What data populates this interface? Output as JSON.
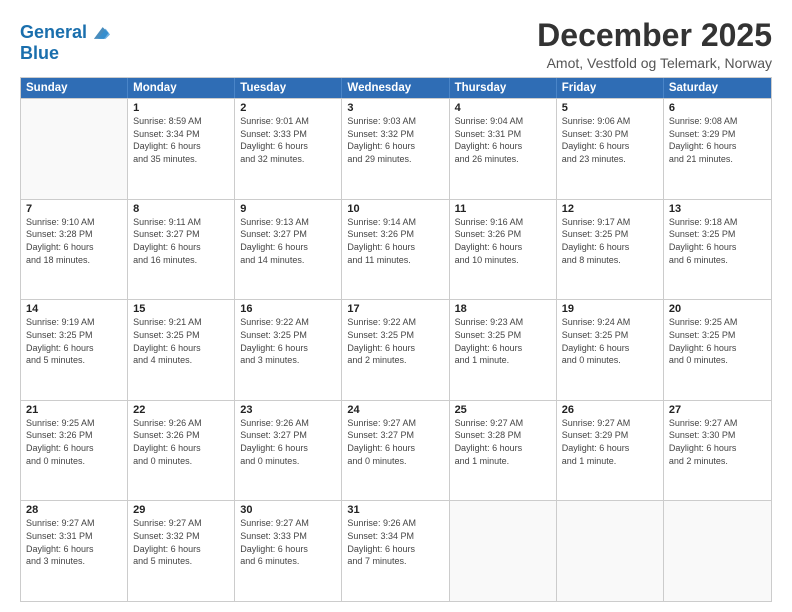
{
  "logo": {
    "line1": "General",
    "line2": "Blue"
  },
  "title": "December 2025",
  "subtitle": "Amot, Vestfold og Telemark, Norway",
  "header_days": [
    "Sunday",
    "Monday",
    "Tuesday",
    "Wednesday",
    "Thursday",
    "Friday",
    "Saturday"
  ],
  "weeks": [
    [
      {
        "day": "",
        "info": ""
      },
      {
        "day": "1",
        "info": "Sunrise: 8:59 AM\nSunset: 3:34 PM\nDaylight: 6 hours\nand 35 minutes."
      },
      {
        "day": "2",
        "info": "Sunrise: 9:01 AM\nSunset: 3:33 PM\nDaylight: 6 hours\nand 32 minutes."
      },
      {
        "day": "3",
        "info": "Sunrise: 9:03 AM\nSunset: 3:32 PM\nDaylight: 6 hours\nand 29 minutes."
      },
      {
        "day": "4",
        "info": "Sunrise: 9:04 AM\nSunset: 3:31 PM\nDaylight: 6 hours\nand 26 minutes."
      },
      {
        "day": "5",
        "info": "Sunrise: 9:06 AM\nSunset: 3:30 PM\nDaylight: 6 hours\nand 23 minutes."
      },
      {
        "day": "6",
        "info": "Sunrise: 9:08 AM\nSunset: 3:29 PM\nDaylight: 6 hours\nand 21 minutes."
      }
    ],
    [
      {
        "day": "7",
        "info": "Sunrise: 9:10 AM\nSunset: 3:28 PM\nDaylight: 6 hours\nand 18 minutes."
      },
      {
        "day": "8",
        "info": "Sunrise: 9:11 AM\nSunset: 3:27 PM\nDaylight: 6 hours\nand 16 minutes."
      },
      {
        "day": "9",
        "info": "Sunrise: 9:13 AM\nSunset: 3:27 PM\nDaylight: 6 hours\nand 14 minutes."
      },
      {
        "day": "10",
        "info": "Sunrise: 9:14 AM\nSunset: 3:26 PM\nDaylight: 6 hours\nand 11 minutes."
      },
      {
        "day": "11",
        "info": "Sunrise: 9:16 AM\nSunset: 3:26 PM\nDaylight: 6 hours\nand 10 minutes."
      },
      {
        "day": "12",
        "info": "Sunrise: 9:17 AM\nSunset: 3:25 PM\nDaylight: 6 hours\nand 8 minutes."
      },
      {
        "day": "13",
        "info": "Sunrise: 9:18 AM\nSunset: 3:25 PM\nDaylight: 6 hours\nand 6 minutes."
      }
    ],
    [
      {
        "day": "14",
        "info": "Sunrise: 9:19 AM\nSunset: 3:25 PM\nDaylight: 6 hours\nand 5 minutes."
      },
      {
        "day": "15",
        "info": "Sunrise: 9:21 AM\nSunset: 3:25 PM\nDaylight: 6 hours\nand 4 minutes."
      },
      {
        "day": "16",
        "info": "Sunrise: 9:22 AM\nSunset: 3:25 PM\nDaylight: 6 hours\nand 3 minutes."
      },
      {
        "day": "17",
        "info": "Sunrise: 9:22 AM\nSunset: 3:25 PM\nDaylight: 6 hours\nand 2 minutes."
      },
      {
        "day": "18",
        "info": "Sunrise: 9:23 AM\nSunset: 3:25 PM\nDaylight: 6 hours\nand 1 minute."
      },
      {
        "day": "19",
        "info": "Sunrise: 9:24 AM\nSunset: 3:25 PM\nDaylight: 6 hours\nand 0 minutes."
      },
      {
        "day": "20",
        "info": "Sunrise: 9:25 AM\nSunset: 3:25 PM\nDaylight: 6 hours\nand 0 minutes."
      }
    ],
    [
      {
        "day": "21",
        "info": "Sunrise: 9:25 AM\nSunset: 3:26 PM\nDaylight: 6 hours\nand 0 minutes."
      },
      {
        "day": "22",
        "info": "Sunrise: 9:26 AM\nSunset: 3:26 PM\nDaylight: 6 hours\nand 0 minutes."
      },
      {
        "day": "23",
        "info": "Sunrise: 9:26 AM\nSunset: 3:27 PM\nDaylight: 6 hours\nand 0 minutes."
      },
      {
        "day": "24",
        "info": "Sunrise: 9:27 AM\nSunset: 3:27 PM\nDaylight: 6 hours\nand 0 minutes."
      },
      {
        "day": "25",
        "info": "Sunrise: 9:27 AM\nSunset: 3:28 PM\nDaylight: 6 hours\nand 1 minute."
      },
      {
        "day": "26",
        "info": "Sunrise: 9:27 AM\nSunset: 3:29 PM\nDaylight: 6 hours\nand 1 minute."
      },
      {
        "day": "27",
        "info": "Sunrise: 9:27 AM\nSunset: 3:30 PM\nDaylight: 6 hours\nand 2 minutes."
      }
    ],
    [
      {
        "day": "28",
        "info": "Sunrise: 9:27 AM\nSunset: 3:31 PM\nDaylight: 6 hours\nand 3 minutes."
      },
      {
        "day": "29",
        "info": "Sunrise: 9:27 AM\nSunset: 3:32 PM\nDaylight: 6 hours\nand 5 minutes."
      },
      {
        "day": "30",
        "info": "Sunrise: 9:27 AM\nSunset: 3:33 PM\nDaylight: 6 hours\nand 6 minutes."
      },
      {
        "day": "31",
        "info": "Sunrise: 9:26 AM\nSunset: 3:34 PM\nDaylight: 6 hours\nand 7 minutes."
      },
      {
        "day": "",
        "info": ""
      },
      {
        "day": "",
        "info": ""
      },
      {
        "day": "",
        "info": ""
      }
    ]
  ]
}
